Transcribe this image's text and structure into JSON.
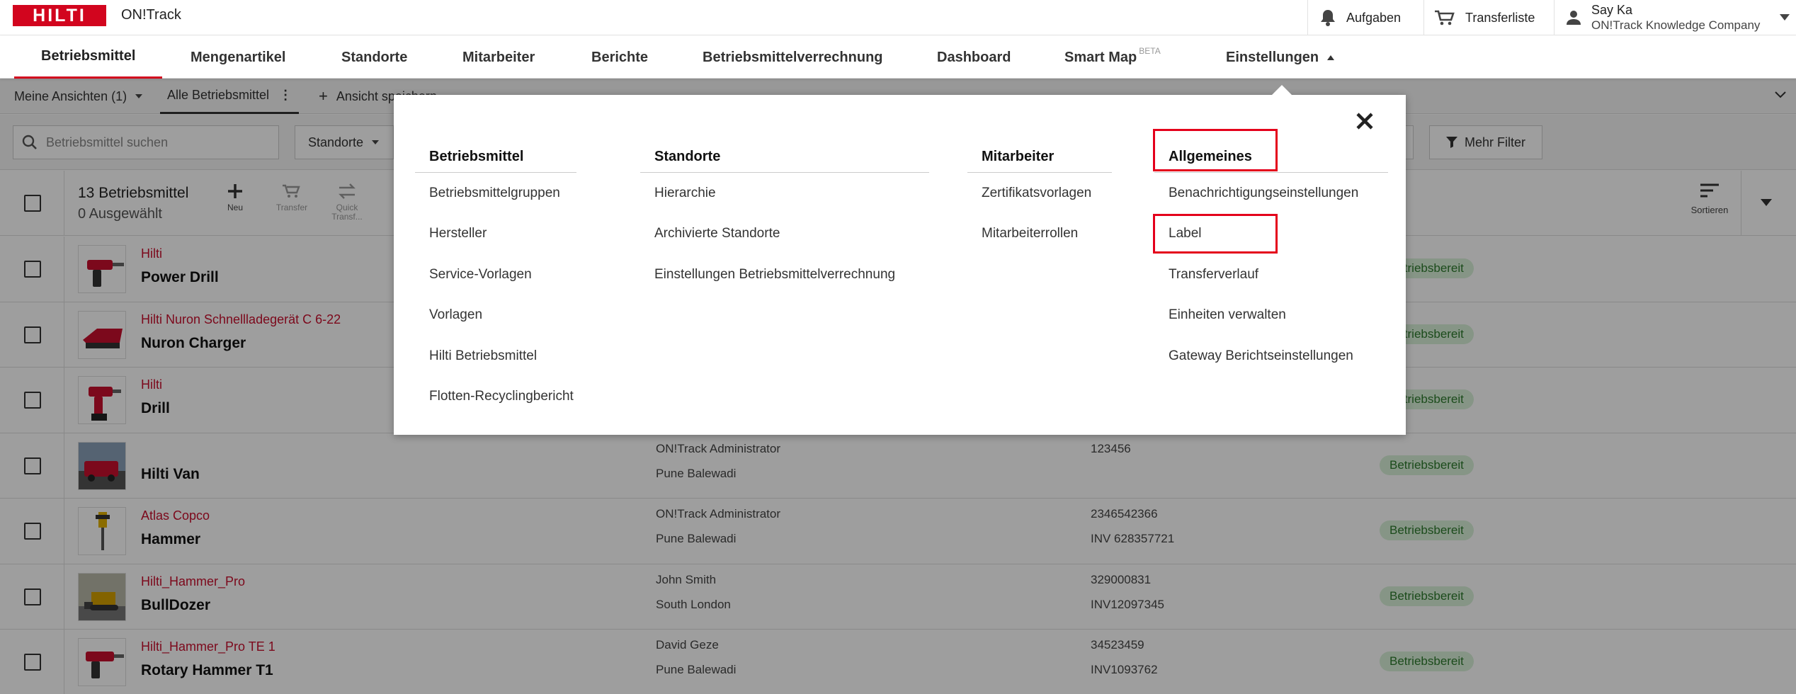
{
  "app": {
    "brand": "HILTI",
    "name": "ON!Track"
  },
  "topbar": {
    "tasks_label": "Aufgaben",
    "transfer_label": "Transferliste",
    "user_name": "Say Ka",
    "user_company": "ON!Track Knowledge Company"
  },
  "nav": {
    "items": [
      "Betriebsmittel",
      "Mengenartikel",
      "Standorte",
      "Mitarbeiter",
      "Berichte",
      "Betriebsmittelverrechnung",
      "Dashboard",
      "Smart Map",
      "Einstellungen"
    ],
    "beta_badge": "BETA",
    "active_index": 0
  },
  "views": {
    "my_views": "Meine Ansichten (1)",
    "all_assets": "Alle Betriebsmittel",
    "save_view": "Ansicht speichern"
  },
  "filters": {
    "search_placeholder": "Betriebsmittel suchen",
    "location_select": "Standorte",
    "more_filters": "Mehr Filter"
  },
  "toolbar": {
    "count_title": "13 Betriebsmittel",
    "selected": "0 Ausgewählt",
    "new_label": "Neu",
    "transfer_label": "Transfer",
    "quick_transfer_label": "Quick Transf...",
    "sort_label": "Sortieren"
  },
  "rows": [
    {
      "manufacturer": "Hilti",
      "name": "Power Drill",
      "responsible": "",
      "location": "",
      "number": "",
      "inventory": "",
      "status": "Betriebsbereit",
      "thumb": "drill-icon"
    },
    {
      "manufacturer": "Hilti Nuron Schnellladegerät C 6-22",
      "name": "Nuron Charger",
      "responsible": "",
      "location": "",
      "number": "",
      "inventory": "",
      "status": "Betriebsbereit",
      "thumb": "charger-icon"
    },
    {
      "manufacturer": "Hilti",
      "name": "Drill",
      "responsible": "",
      "location": "",
      "number": "",
      "inventory": "",
      "status": "Betriebsbereit",
      "thumb": "drill-icon"
    },
    {
      "manufacturer": "",
      "name": "Hilti Van",
      "responsible": "ON!Track Administrator",
      "location": "Pune Balewadi",
      "number": "123456",
      "inventory": "",
      "status": "Betriebsbereit",
      "thumb": "van-icon"
    },
    {
      "manufacturer": "Atlas Copco",
      "name": "Hammer",
      "responsible": "ON!Track Administrator",
      "location": "Pune Balewadi",
      "number": "2346542366",
      "inventory": "INV 628357721",
      "status": "Betriebsbereit",
      "thumb": "hammer-icon"
    },
    {
      "manufacturer": "Hilti_Hammer_Pro",
      "name": "BullDozer",
      "responsible": "John Smith",
      "location": "South London",
      "number": "329000831",
      "inventory": "INV12097345",
      "status": "Betriebsbereit",
      "thumb": "bulldozer-icon"
    },
    {
      "manufacturer": "Hilti_Hammer_Pro TE 1",
      "name": "Rotary Hammer T1",
      "responsible": "David Geze",
      "location": "Pune Balewadi",
      "number": "34523459",
      "inventory": "INV1093762",
      "status": "Betriebsbereit",
      "thumb": "drill-icon"
    }
  ],
  "settings_menu": {
    "columns": [
      {
        "title": "Betriebsmittel",
        "links": [
          "Betriebsmittelgruppen",
          "Hersteller",
          "Service-Vorlagen",
          "Vorlagen",
          "Hilti Betriebsmittel",
          "Flotten-Recyclingbericht"
        ]
      },
      {
        "title": "Standorte",
        "links": [
          "Hierarchie",
          "Archivierte Standorte",
          "Einstellungen Betriebsmittelverrechnung"
        ]
      },
      {
        "title": "Mitarbeiter",
        "links": [
          "Zertifikatsvorlagen",
          "Mitarbeiterrollen"
        ]
      },
      {
        "title": "Allgemeines",
        "links": [
          "Benachrichtigungseinstellungen",
          "Label",
          "Transferverlauf",
          "Einheiten verwalten",
          "Gateway Berichtseinstellungen"
        ]
      }
    ],
    "highlighted": [
      "Allgemeines",
      "Label"
    ]
  },
  "colors": {
    "brand": "#d2051e",
    "highlight": "#e4001b",
    "status_bg": "#d8f0d8",
    "status_text": "#2d7a2d"
  }
}
